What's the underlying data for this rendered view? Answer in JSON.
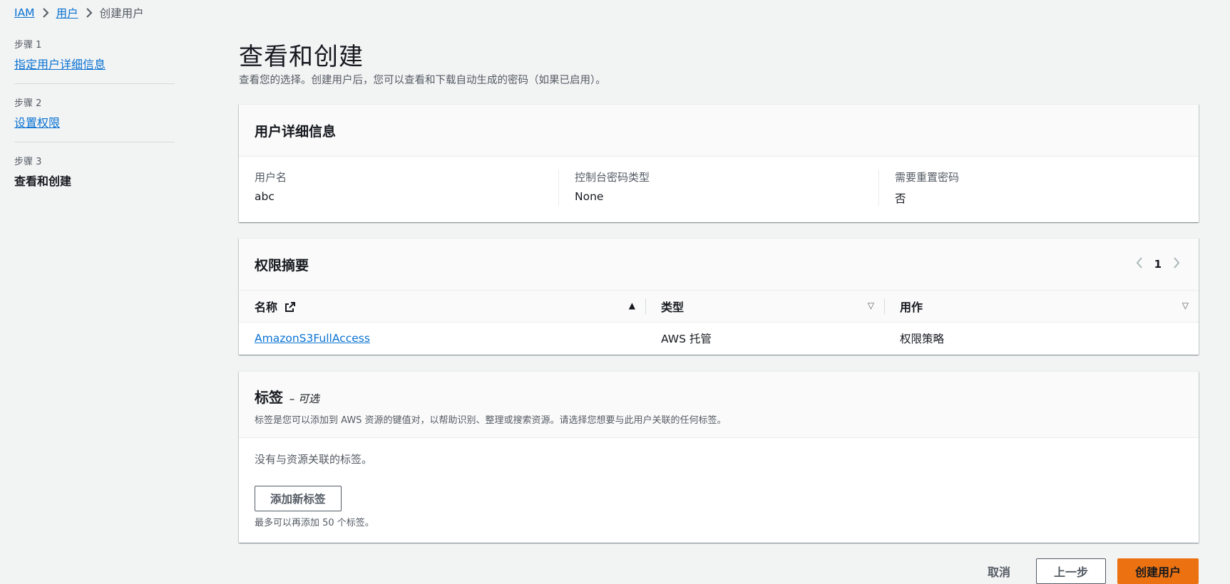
{
  "breadcrumb": {
    "root": "IAM",
    "parent": "用户",
    "current": "创建用户"
  },
  "steps": [
    {
      "number": "步骤 1",
      "title": "指定用户详细信息"
    },
    {
      "number": "步骤 2",
      "title": "设置权限"
    },
    {
      "number": "步骤 3",
      "title": "查看和创建"
    }
  ],
  "page": {
    "title": "查看和创建",
    "description": "查看您的选择。创建用户后，您可以查看和下载自动生成的密码（如果已启用）。"
  },
  "user_details": {
    "heading": "用户详细信息",
    "fields": [
      {
        "label": "用户名",
        "value": "abc"
      },
      {
        "label": "控制台密码类型",
        "value": "None"
      },
      {
        "label": "需要重置密码",
        "value": "否"
      }
    ]
  },
  "permissions": {
    "heading": "权限摘要",
    "page": "1",
    "columns": [
      "名称",
      "类型",
      "用作"
    ],
    "rows": [
      {
        "name": "AmazonS3FullAccess",
        "type": "AWS 托管",
        "used_as": "权限策略"
      }
    ]
  },
  "tags": {
    "heading": "标签",
    "optional": "– 可选",
    "description": "标签是您可以添加到 AWS 资源的键值对，以帮助识别、整理或搜索资源。请选择您想要与此用户关联的任何标签。",
    "empty": "没有与资源关联的标签。",
    "add_button": "添加新标签",
    "limit": "最多可以再添加 50 个标签。"
  },
  "actions": {
    "cancel": "取消",
    "previous": "上一步",
    "create": "创建用户"
  },
  "colors": {
    "link": "#0972d3",
    "primary": "#ec7211",
    "background": "#f2f3f3"
  }
}
